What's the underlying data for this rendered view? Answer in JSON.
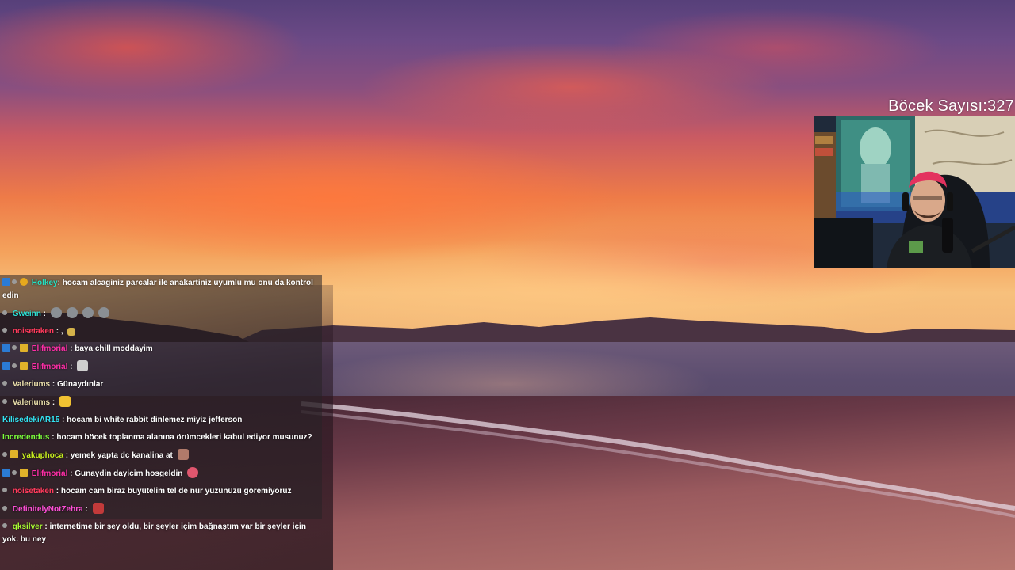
{
  "overlay": {
    "counter_text": "Böcek Sayısı:327"
  },
  "chat": {
    "messages": [
      {
        "nick": "Holkey",
        "nick_color": "#24e0c2",
        "sep": ": ",
        "text": "hocam alcaginiz parcalar ile anakartiniz uyumlu mu onu da kontrol edin"
      },
      {
        "nick": "Gweinn",
        "nick_color": "#2ce0d4",
        "sep": " : ",
        "text": ""
      },
      {
        "nick": "noisetaken",
        "nick_color": "#ff3b5c",
        "sep": " : ",
        "text": ","
      },
      {
        "nick": "Elifmorial",
        "nick_color": "#ff2ea7",
        "sep": " : ",
        "text": "baya chill moddayim"
      },
      {
        "nick": "Elifmorial",
        "nick_color": "#ff2ea7",
        "sep": " : ",
        "text": ""
      },
      {
        "nick": "Valeriums",
        "nick_color": "#f2e6b0",
        "sep": " : ",
        "text": "Günaydınlar"
      },
      {
        "nick": "Valeriums",
        "nick_color": "#f2e6b0",
        "sep": " : ",
        "text": ""
      },
      {
        "nick": "KilisedekiAR15",
        "nick_color": "#33e3f2",
        "sep": " : ",
        "text": "hocam bi white rabbit dinlemez miyiz jefferson"
      },
      {
        "nick": "Incredendus",
        "nick_color": "#7cff3c",
        "sep": " : ",
        "text": "hocam böcek toplanma alanına örümcekleri kabul ediyor musunuz?"
      },
      {
        "nick": "yakuphoca",
        "nick_color": "#c8f01e",
        "sep": " : ",
        "text": "yemek yapta dc kanalina at"
      },
      {
        "nick": "Elifmorial",
        "nick_color": "#ff2ea7",
        "sep": " : ",
        "text": "Gunaydin dayicim hosgeldin"
      },
      {
        "nick": "noisetaken",
        "nick_color": "#ff3b5c",
        "sep": " : ",
        "text": "hocam cam biraz büyütelim tel de nur yüzünüzü göremiyoruz"
      },
      {
        "nick": "DefinitelyNotZehra",
        "nick_color": "#ff4fd8",
        "sep": " : ",
        "text": ""
      },
      {
        "nick": "qksilver",
        "nick_color": "#aaff33",
        "sep": " : ",
        "text": "internetime bir şey oldu, bir şeyler içim bağnaştım var bir şeyler için yok. bu ney"
      }
    ]
  },
  "colors": {
    "chat_bg": "rgba(40,35,38,.55)",
    "prime_badge": "#2b7bd4",
    "sub_badge": "#e0b22a"
  },
  "icons": {
    "prime": "prime-badge-icon",
    "mod": "moderator-badge-icon",
    "sub": "subscriber-badge-icon",
    "emote": "emote-icon"
  }
}
